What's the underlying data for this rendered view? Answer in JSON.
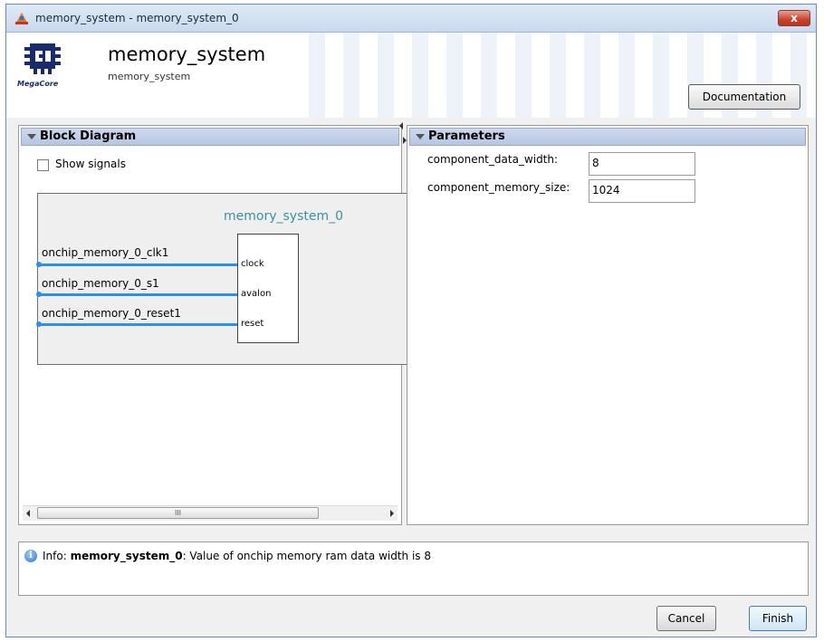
{
  "window": {
    "title": "memory_system - memory_system_0",
    "close_label": "x"
  },
  "header": {
    "name": "memory_system",
    "subname": "memory_system",
    "logo_text": "MegaCore",
    "documentation_label": "Documentation"
  },
  "block_diagram": {
    "heading": "Block Diagram",
    "show_signals_label": "Show signals",
    "show_signals_checked": false,
    "instance_name": "memory_system_0",
    "signals": [
      {
        "name": "onchip_memory_0_clk1",
        "port": "clock"
      },
      {
        "name": "onchip_memory_0_s1",
        "port": "avalon"
      },
      {
        "name": "onchip_memory_0_reset1",
        "port": "reset"
      }
    ],
    "scroll_thumb_grip": "III"
  },
  "parameters": {
    "heading": "Parameters",
    "items": [
      {
        "label": "component_data_width:",
        "value": "8"
      },
      {
        "label": "component_memory_size:",
        "value": "1024"
      }
    ]
  },
  "messages": {
    "icon": "info-icon",
    "prefix": "Info:",
    "source": "memory_system_0",
    "text": ": Value of onchip memory ram data width is 8"
  },
  "buttons": {
    "cancel": "Cancel",
    "finish": "Finish"
  },
  "colors": {
    "signal_line": "#2a8ff2",
    "instance_name": "#3c8f9c",
    "panel_header": "#b6c6e2"
  }
}
